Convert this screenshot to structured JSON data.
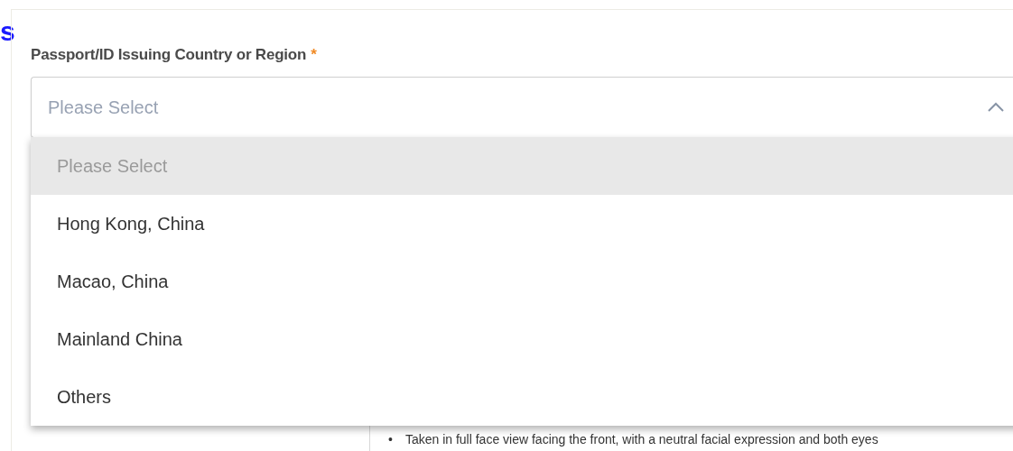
{
  "heading_fragment": "s",
  "field": {
    "label": "Passport/ID Issuing Country or Region",
    "required_mark": "*",
    "placeholder": "Please Select",
    "expanded": true
  },
  "options": [
    {
      "label": "Please Select",
      "selected": true,
      "disabled": true
    },
    {
      "label": "Hong Kong, China",
      "selected": false,
      "disabled": false
    },
    {
      "label": "Macao, China",
      "selected": false,
      "disabled": false
    },
    {
      "label": "Mainland China",
      "selected": false,
      "disabled": false
    },
    {
      "label": "Others",
      "selected": false,
      "disabled": false
    }
  ],
  "photo_requirements": [
    {
      "bullet": "•",
      "text": "Taken in full face view facing the front, with a neutral facial expression and both eyes"
    }
  ]
}
